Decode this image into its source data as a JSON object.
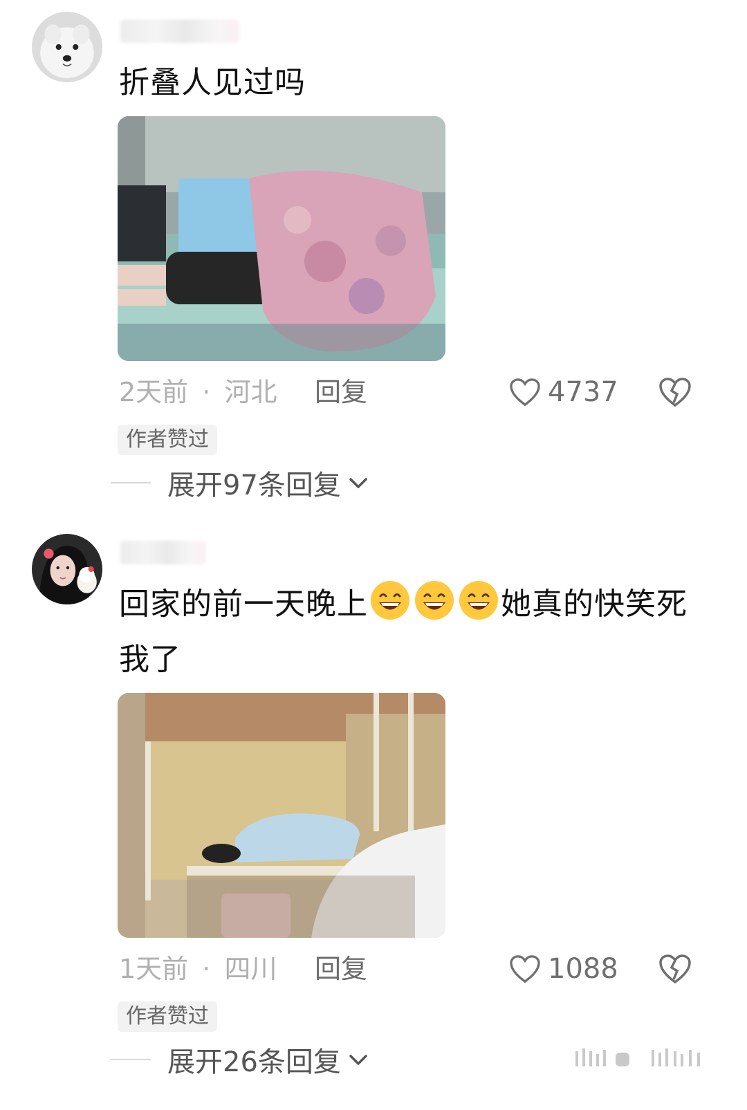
{
  "comments": [
    {
      "text": "折叠人见过吗",
      "time": "2天前",
      "sep": "·",
      "location": "河北",
      "reply_label": "回复",
      "likes": "4737",
      "badge": "作者赞过",
      "expand_label": "展开97条回复"
    },
    {
      "text_before": "回家的前一天晚上",
      "text_after": "她真的快笑死我了",
      "emoji_count": 3,
      "time": "1天前",
      "sep": "·",
      "location": "四川",
      "reply_label": "回复",
      "likes": "1088",
      "badge": "作者赞过",
      "expand_label": "展开26条回复"
    }
  ],
  "icons": {
    "like": "heart-outline-icon",
    "dislike": "broken-heart-icon",
    "expand": "chevron-down-icon",
    "emoji": "grinning-face-emoji"
  },
  "colors": {
    "meta_gray": "#b0b0b0",
    "text": "#111111",
    "badge_bg": "#f2f2f2"
  }
}
